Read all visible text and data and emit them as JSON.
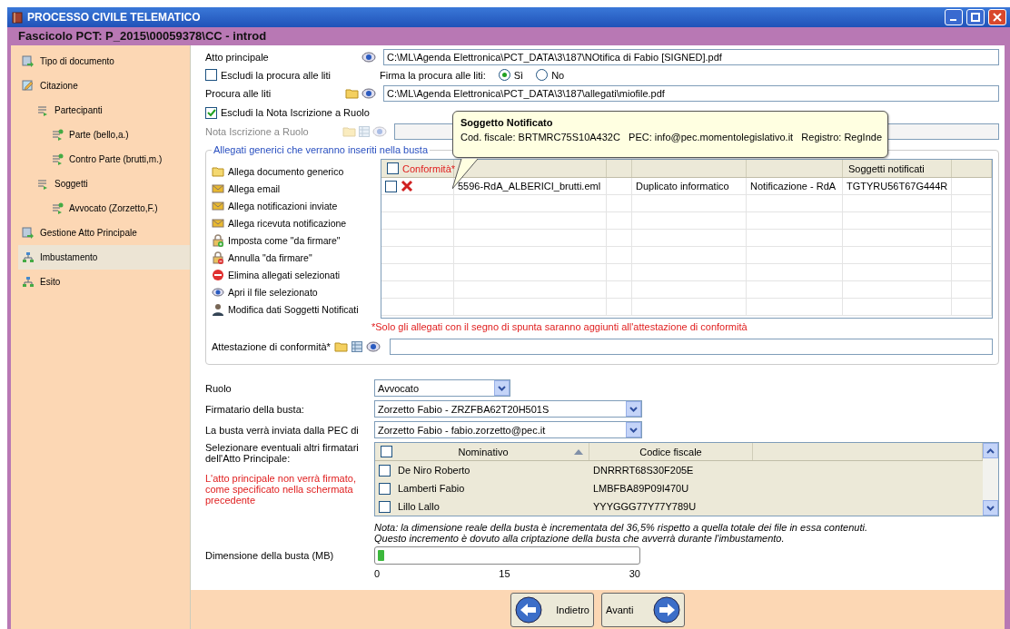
{
  "window": {
    "title": "PROCESSO CIVILE TELEMATICO"
  },
  "header": {
    "title": "Fascicolo PCT: P_2015\\00059378\\CC - introd"
  },
  "sidebar": {
    "items": [
      {
        "label": "Tipo di documento",
        "kind": "doc",
        "selected": false
      },
      {
        "label": "Citazione",
        "kind": "edit",
        "selected": false,
        "children": [
          {
            "label": "Partecipanti",
            "kind": "list",
            "selected": false,
            "children": [
              {
                "label": "Parte (bello,a.)",
                "kind": "listadd",
                "selected": false
              },
              {
                "label": "Contro Parte (brutti,m.)",
                "kind": "listadd",
                "selected": false
              }
            ]
          },
          {
            "label": "Soggetti",
            "kind": "list",
            "selected": false,
            "children": [
              {
                "label": "Avvocato (Zorzetto,F.)",
                "kind": "listadd",
                "selected": false
              }
            ]
          }
        ]
      },
      {
        "label": "Gestione Atto Principale",
        "kind": "doc",
        "selected": false
      },
      {
        "label": "Imbustamento",
        "kind": "net",
        "selected": true
      },
      {
        "label": "Esito",
        "kind": "net",
        "selected": false
      }
    ]
  },
  "atto_principale": {
    "label": "Atto principale",
    "value": "C:\\ML\\Agenda Elettronica\\PCT_DATA\\3\\187\\NOtifica di Fabio [SIGNED].pdf"
  },
  "escludi_procura": {
    "label": "Escludi la procura alle liti",
    "checked": false
  },
  "firma_procura": {
    "label": "Firma la procura alle liti:",
    "options": [
      {
        "label": "Sì",
        "selected": true
      },
      {
        "label": "No",
        "selected": false
      }
    ]
  },
  "procura": {
    "label": "Procura alle liti",
    "value": "C:\\ML\\Agenda Elettronica\\PCT_DATA\\3\\187\\allegati\\miofile.pdf"
  },
  "escludi_nota": {
    "label": "Escludi la Nota Iscrizione a Ruolo",
    "checked": true
  },
  "nota": {
    "label": "Nota Iscrizione a Ruolo",
    "disabled": true
  },
  "allegati": {
    "legend": "Allegati generici che verranno inseriti nella busta",
    "actions": [
      {
        "label": "Allega documento generico",
        "kind": "folder"
      },
      {
        "label": "Allega email",
        "kind": "mail"
      },
      {
        "label": "Allega notificazioni inviate",
        "kind": "mail"
      },
      {
        "label": "Allega ricevuta notificazione",
        "kind": "mail"
      },
      {
        "label": "Imposta come \"da firmare\"",
        "kind": "lockadd"
      },
      {
        "label": "Annulla \"da firmare\"",
        "kind": "lockdel"
      },
      {
        "label": "Elimina allegati selezionati",
        "kind": "delete"
      },
      {
        "label": "Apri il file selezionato",
        "kind": "eye"
      },
      {
        "label": "Modifica dati Soggetti Notificati",
        "kind": "person"
      }
    ],
    "table": {
      "header_checked": false,
      "columns": [
        {
          "label": "Conformità*",
          "kind": "check"
        },
        {
          "kind": "plain"
        },
        {
          "kind": "plain"
        },
        {
          "kind": "plain"
        },
        {
          "kind": "plain"
        },
        {
          "label": "Soggetti notificati",
          "kind": "plain"
        }
      ],
      "rows": [
        {
          "checked": false,
          "signed": false,
          "cells": [
            "5596-RdA_ALBERICI_brutti.eml",
            "",
            "Duplicato informatico",
            "Notificazione - RdA",
            "TGTYRU56T67G444R"
          ]
        }
      ]
    },
    "note": "*Solo gli allegati con il segno di spunta saranno aggiunti all'attestazione di conformità",
    "attestazione_label": "Attestazione di conformità*"
  },
  "tooltip": {
    "title": "Soggetto Notificato",
    "text": "Cod. fiscale: BRTMRC75S10A432C   PEC: info@pec.momentolegislativo.it   Registro: RegInde"
  },
  "ruolo": {
    "label": "Ruolo",
    "value": "Avvocato"
  },
  "firmatario": {
    "label": "Firmatario della busta:",
    "value": "Zorzetto Fabio - ZRZFBA62T20H501S"
  },
  "pec": {
    "label": "La busta verrà inviata dalla PEC di",
    "value": "Zorzetto Fabio - fabio.zorzetto@pec.it"
  },
  "altri_firmatari": {
    "label": "Selezionare eventuali altri firmatari dell'Atto Principale:",
    "warning": "L'atto principale non verrà firmato, come specificato nella schermata precedente",
    "header_checked": false,
    "columns": [
      "Nominativo",
      "Codice fiscale"
    ],
    "rows": [
      {
        "name": "De Niro Roberto",
        "code": "DNRRRT68S30F205E",
        "checked": false
      },
      {
        "name": "Lamberti Fabio",
        "code": "LMBFBA89P09I470U",
        "checked": false
      },
      {
        "name": "Lillo Lallo",
        "code": "YYYGGG77Y77Y789U",
        "checked": false
      }
    ]
  },
  "nota_dimensione": [
    "Nota: la dimensione reale della busta è incrementata del 36,5% rispetto a quella totale dei file in essa contenuti.",
    "Questo incremento è dovuto alla criptazione della busta che avverrà durante l'imbustamento."
  ],
  "dimensione": {
    "label": "Dimensione della busta (MB)",
    "level": 0.025,
    "ticks": [
      "0",
      "15",
      "30"
    ]
  },
  "buttons": [
    {
      "label": "Indietro",
      "kind": "back"
    },
    {
      "label": "Avanti",
      "kind": "next"
    }
  ]
}
